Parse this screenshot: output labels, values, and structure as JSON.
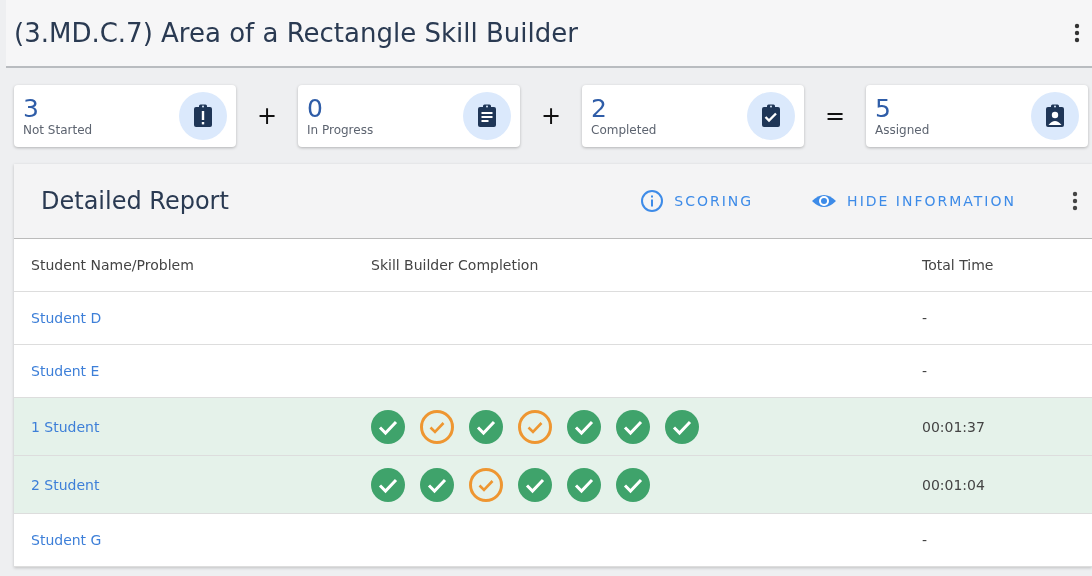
{
  "header": {
    "title": "(3.MD.C.7) Area of a Rectangle Skill Builder"
  },
  "stats": [
    {
      "kind": "not_started",
      "count": "3",
      "label": "Not Started"
    },
    {
      "kind": "operator",
      "symbol": "+"
    },
    {
      "kind": "in_progress",
      "count": "0",
      "label": "In Progress"
    },
    {
      "kind": "operator",
      "symbol": "+"
    },
    {
      "kind": "completed",
      "count": "2",
      "label": "Completed"
    },
    {
      "kind": "operator",
      "symbol": "="
    },
    {
      "kind": "assigned",
      "count": "5",
      "label": "Assigned"
    }
  ],
  "report": {
    "title": "Detailed Report",
    "actions": [
      {
        "kind": "info",
        "label": "SCORING"
      },
      {
        "kind": "eye",
        "label": "HIDE INFORMATION"
      }
    ],
    "table": {
      "columns": [
        "Student Name/Problem",
        "Skill Builder Completion",
        "Total Time"
      ],
      "rows": [
        {
          "name": "Student D",
          "completed": false,
          "problems": [],
          "time": "-"
        },
        {
          "name": "Student E",
          "completed": false,
          "problems": [],
          "time": "-"
        },
        {
          "name": "1 Student",
          "completed": true,
          "problems": [
            {
              "kind": "correct"
            },
            {
              "kind": "partial"
            },
            {
              "kind": "correct"
            },
            {
              "kind": "partial"
            },
            {
              "kind": "correct"
            },
            {
              "kind": "correct"
            },
            {
              "kind": "correct"
            }
          ],
          "time": "00:01:37"
        },
        {
          "name": "2 Student",
          "completed": true,
          "problems": [
            {
              "kind": "correct"
            },
            {
              "kind": "correct"
            },
            {
              "kind": "partial"
            },
            {
              "kind": "correct"
            },
            {
              "kind": "correct"
            },
            {
              "kind": "correct"
            }
          ],
          "time": "00:01:04"
        },
        {
          "name": "Student G",
          "completed": false,
          "problems": [],
          "time": "-"
        }
      ]
    }
  }
}
